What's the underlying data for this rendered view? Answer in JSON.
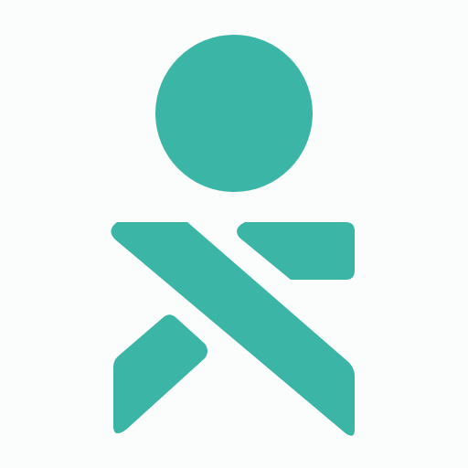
{
  "logo": {
    "icon": "person-figure-logo-icon",
    "color": "#3bb5a6",
    "background": "#fbfdfd"
  }
}
